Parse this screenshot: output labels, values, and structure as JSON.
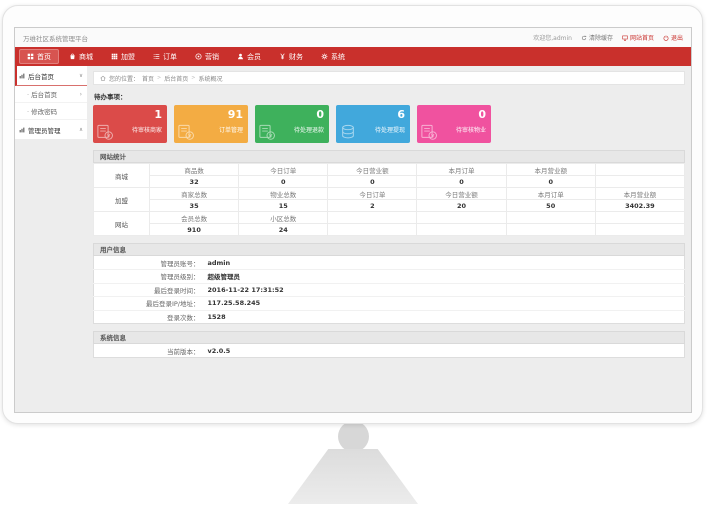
{
  "topbar": {
    "brand": "万维社区系统管理平台",
    "welcome": "欢迎您,admin",
    "links": [
      {
        "label": "清除缓存",
        "icon": "refresh-icon",
        "color": "default"
      },
      {
        "label": "网站首页",
        "icon": "site-icon",
        "color": "red"
      },
      {
        "label": "退出",
        "icon": "logout-icon",
        "color": "red"
      }
    ]
  },
  "navbar": {
    "background": "#c9302c",
    "items": [
      {
        "label": "首页",
        "icon": "home-icon",
        "active": true
      },
      {
        "label": "商城",
        "icon": "mall-icon",
        "active": false
      },
      {
        "label": "加盟",
        "icon": "franchise-icon",
        "active": false
      },
      {
        "label": "订单",
        "icon": "order-icon",
        "active": false
      },
      {
        "label": "营销",
        "icon": "marketing-icon",
        "active": false
      },
      {
        "label": "会员",
        "icon": "member-icon",
        "active": false
      },
      {
        "label": "财务",
        "icon": "finance-icon",
        "active": false
      },
      {
        "label": "系统",
        "icon": "system-icon",
        "active": false
      }
    ]
  },
  "sidebar": {
    "groups": [
      {
        "label": "后台首页",
        "icon": "chart-icon",
        "chevron": "∨",
        "active": true,
        "children": [
          {
            "label": "后台首页",
            "arrow": "›"
          },
          {
            "label": "修改密码",
            "arrow": ""
          }
        ]
      },
      {
        "label": "管理员管理",
        "icon": "chart-icon",
        "chevron": "∧",
        "active": false,
        "children": []
      }
    ]
  },
  "breadcrumb": {
    "prefix": "您的位置：",
    "separator": ">",
    "items": [
      "首页",
      "后台首页",
      "系统概况"
    ]
  },
  "todo": {
    "title": "待办事项：",
    "cards": [
      {
        "value": "1",
        "label": "待审核商家",
        "color": "#db4b49",
        "icon": "invoice-icon"
      },
      {
        "value": "91",
        "label": "订单管理",
        "color": "#f3ac43",
        "icon": "invoice-icon"
      },
      {
        "value": "0",
        "label": "待处理退款",
        "color": "#3eb15c",
        "icon": "invoice-icon"
      },
      {
        "value": "6",
        "label": "待处理提现",
        "color": "#41a8dc",
        "icon": "coins-icon"
      },
      {
        "value": "0",
        "label": "待审核物业",
        "color": "#f0529f",
        "icon": "invoice-icon"
      }
    ]
  },
  "stats": {
    "title": "网站统计",
    "groups": [
      {
        "name": "商城",
        "headers": [
          "商品数",
          "今日订单",
          "今日营业额",
          "本月订单",
          "本月营业额",
          ""
        ],
        "values": [
          "32",
          "0",
          "0",
          "0",
          "0",
          ""
        ]
      },
      {
        "name": "加盟",
        "headers": [
          "商家总数",
          "物业总数",
          "今日订单",
          "今日营业额",
          "本月订单",
          "本月营业额"
        ],
        "values": [
          "35",
          "15",
          "2",
          "20",
          "50",
          "3402.39"
        ]
      },
      {
        "name": "网站",
        "headers": [
          "会员总数",
          "小区总数",
          "",
          "",
          "",
          ""
        ],
        "values": [
          "910",
          "24",
          "",
          "",
          "",
          ""
        ]
      }
    ]
  },
  "user_info": {
    "title": "用户信息",
    "rows": [
      {
        "label": "管理员账号：",
        "value": "admin"
      },
      {
        "label": "管理员级别：",
        "value": "超级管理员"
      },
      {
        "label": "最后登录时间：",
        "value": "2016-11-22 17:31:52"
      },
      {
        "label": "最后登录IP/地址：",
        "value": "117.25.58.245"
      },
      {
        "label": "登录次数：",
        "value": "1528"
      }
    ]
  },
  "system_info": {
    "title": "系统信息",
    "rows": [
      {
        "label": "当前版本：",
        "value": "v2.0.5"
      }
    ]
  }
}
